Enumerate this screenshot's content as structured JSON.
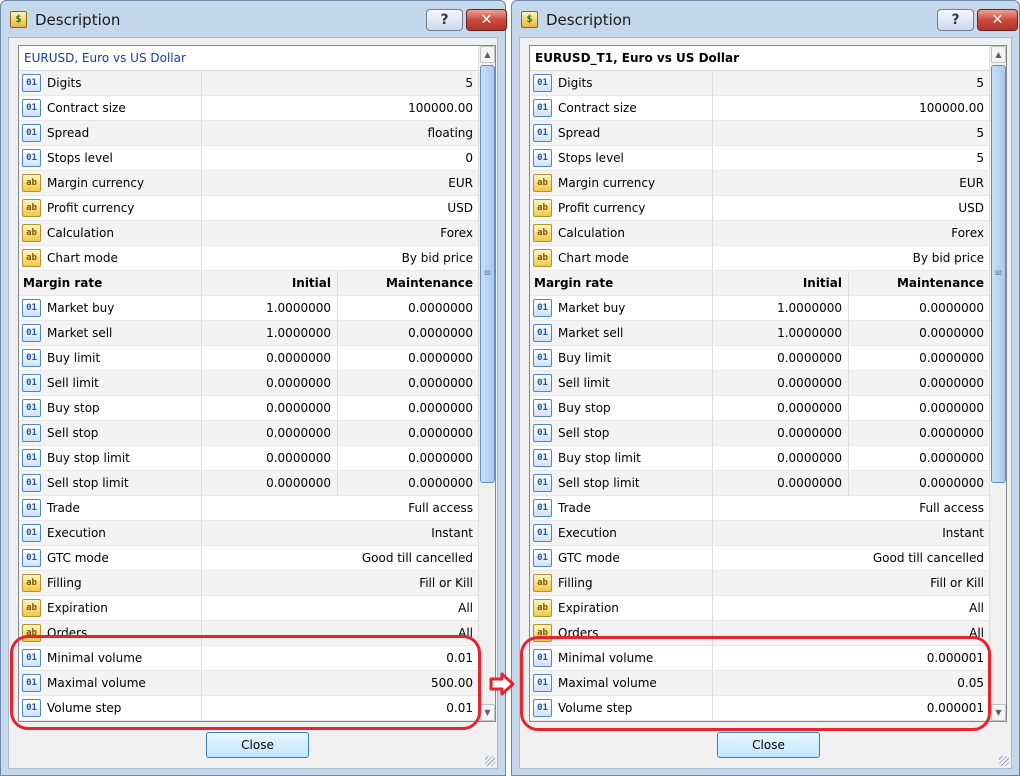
{
  "windows": [
    {
      "title": "Description",
      "help_label": "?",
      "close_glyph": "✕",
      "header": "EURUSD, Euro vs US Dollar",
      "rows": [
        {
          "type": "prop",
          "icon": "num",
          "name": "Digits",
          "value": "5"
        },
        {
          "type": "prop",
          "icon": "num",
          "name": "Contract size",
          "value": "100000.00"
        },
        {
          "type": "prop",
          "icon": "num",
          "name": "Spread",
          "value": "floating"
        },
        {
          "type": "prop",
          "icon": "num",
          "name": "Stops level",
          "value": "0"
        },
        {
          "type": "prop",
          "icon": "str",
          "name": "Margin currency",
          "value": "EUR"
        },
        {
          "type": "prop",
          "icon": "str",
          "name": "Profit currency",
          "value": "USD"
        },
        {
          "type": "prop",
          "icon": "str",
          "name": "Calculation",
          "value": "Forex"
        },
        {
          "type": "prop",
          "icon": "str",
          "name": "Chart mode",
          "value": "By bid price"
        },
        {
          "type": "section",
          "name": "Margin rate",
          "v1": "Initial",
          "v2": "Maintenance"
        },
        {
          "type": "margin",
          "icon": "num",
          "name": "Market buy",
          "v1": "1.0000000",
          "v2": "0.0000000"
        },
        {
          "type": "margin",
          "icon": "num",
          "name": "Market sell",
          "v1": "1.0000000",
          "v2": "0.0000000"
        },
        {
          "type": "margin",
          "icon": "num",
          "name": "Buy limit",
          "v1": "0.0000000",
          "v2": "0.0000000"
        },
        {
          "type": "margin",
          "icon": "num",
          "name": "Sell limit",
          "v1": "0.0000000",
          "v2": "0.0000000"
        },
        {
          "type": "margin",
          "icon": "num",
          "name": "Buy stop",
          "v1": "0.0000000",
          "v2": "0.0000000"
        },
        {
          "type": "margin",
          "icon": "num",
          "name": "Sell stop",
          "v1": "0.0000000",
          "v2": "0.0000000"
        },
        {
          "type": "margin",
          "icon": "num",
          "name": "Buy stop limit",
          "v1": "0.0000000",
          "v2": "0.0000000"
        },
        {
          "type": "margin",
          "icon": "num",
          "name": "Sell stop limit",
          "v1": "0.0000000",
          "v2": "0.0000000"
        },
        {
          "type": "prop",
          "icon": "num",
          "name": "Trade",
          "value": "Full access"
        },
        {
          "type": "prop",
          "icon": "num",
          "name": "Execution",
          "value": "Instant"
        },
        {
          "type": "prop",
          "icon": "num",
          "name": "GTC mode",
          "value": "Good till cancelled"
        },
        {
          "type": "prop",
          "icon": "str",
          "name": "Filling",
          "value": "Fill or Kill"
        },
        {
          "type": "prop",
          "icon": "str",
          "name": "Expiration",
          "value": "All"
        },
        {
          "type": "prop",
          "icon": "str",
          "name": "Orders",
          "value": "All"
        },
        {
          "type": "prop",
          "icon": "num",
          "name": "Minimal volume",
          "value": "0.01"
        },
        {
          "type": "prop",
          "icon": "num",
          "name": "Maximal volume",
          "value": "500.00"
        },
        {
          "type": "prop",
          "icon": "num",
          "name": "Volume step",
          "value": "0.01"
        }
      ],
      "close_button_label": "Close"
    },
    {
      "title": "Description",
      "help_label": "?",
      "close_glyph": "✕",
      "header": "EURUSD_T1, Euro vs US Dollar",
      "rows": [
        {
          "type": "prop",
          "icon": "num",
          "name": "Digits",
          "value": "5"
        },
        {
          "type": "prop",
          "icon": "num",
          "name": "Contract size",
          "value": "100000.00"
        },
        {
          "type": "prop",
          "icon": "num",
          "name": "Spread",
          "value": "5"
        },
        {
          "type": "prop",
          "icon": "num",
          "name": "Stops level",
          "value": "5"
        },
        {
          "type": "prop",
          "icon": "str",
          "name": "Margin currency",
          "value": "EUR"
        },
        {
          "type": "prop",
          "icon": "str",
          "name": "Profit currency",
          "value": "USD"
        },
        {
          "type": "prop",
          "icon": "str",
          "name": "Calculation",
          "value": "Forex"
        },
        {
          "type": "prop",
          "icon": "str",
          "name": "Chart mode",
          "value": "By bid price"
        },
        {
          "type": "section",
          "name": "Margin rate",
          "v1": "Initial",
          "v2": "Maintenance"
        },
        {
          "type": "margin",
          "icon": "num",
          "name": "Market buy",
          "v1": "1.0000000",
          "v2": "0.0000000"
        },
        {
          "type": "margin",
          "icon": "num",
          "name": "Market sell",
          "v1": "1.0000000",
          "v2": "0.0000000"
        },
        {
          "type": "margin",
          "icon": "num",
          "name": "Buy limit",
          "v1": "0.0000000",
          "v2": "0.0000000"
        },
        {
          "type": "margin",
          "icon": "num",
          "name": "Sell limit",
          "v1": "0.0000000",
          "v2": "0.0000000"
        },
        {
          "type": "margin",
          "icon": "num",
          "name": "Buy stop",
          "v1": "0.0000000",
          "v2": "0.0000000"
        },
        {
          "type": "margin",
          "icon": "num",
          "name": "Sell stop",
          "v1": "0.0000000",
          "v2": "0.0000000"
        },
        {
          "type": "margin",
          "icon": "num",
          "name": "Buy stop limit",
          "v1": "0.0000000",
          "v2": "0.0000000"
        },
        {
          "type": "margin",
          "icon": "num",
          "name": "Sell stop limit",
          "v1": "0.0000000",
          "v2": "0.0000000"
        },
        {
          "type": "prop",
          "icon": "num",
          "name": "Trade",
          "value": "Full access"
        },
        {
          "type": "prop",
          "icon": "num",
          "name": "Execution",
          "value": "Instant"
        },
        {
          "type": "prop",
          "icon": "num",
          "name": "GTC mode",
          "value": "Good till cancelled"
        },
        {
          "type": "prop",
          "icon": "str",
          "name": "Filling",
          "value": "Fill or Kill"
        },
        {
          "type": "prop",
          "icon": "str",
          "name": "Expiration",
          "value": "All"
        },
        {
          "type": "prop",
          "icon": "str",
          "name": "Orders",
          "value": "All"
        },
        {
          "type": "prop",
          "icon": "num",
          "name": "Minimal volume",
          "value": "0.000001"
        },
        {
          "type": "prop",
          "icon": "num",
          "name": "Maximal volume",
          "value": "0.05"
        },
        {
          "type": "prop",
          "icon": "num",
          "name": "Volume step",
          "value": "0.000001"
        }
      ],
      "close_button_label": "Close"
    }
  ],
  "icons": {
    "window": "symbol-properties-icon",
    "num": "numeric-property-icon",
    "str": "string-property-icon",
    "num_glyph": "01",
    "str_glyph": "ab"
  },
  "colors": {
    "highlight": "#e8222e",
    "window_frame": "#c5d7ea",
    "header_link": "#1a3aa8"
  }
}
